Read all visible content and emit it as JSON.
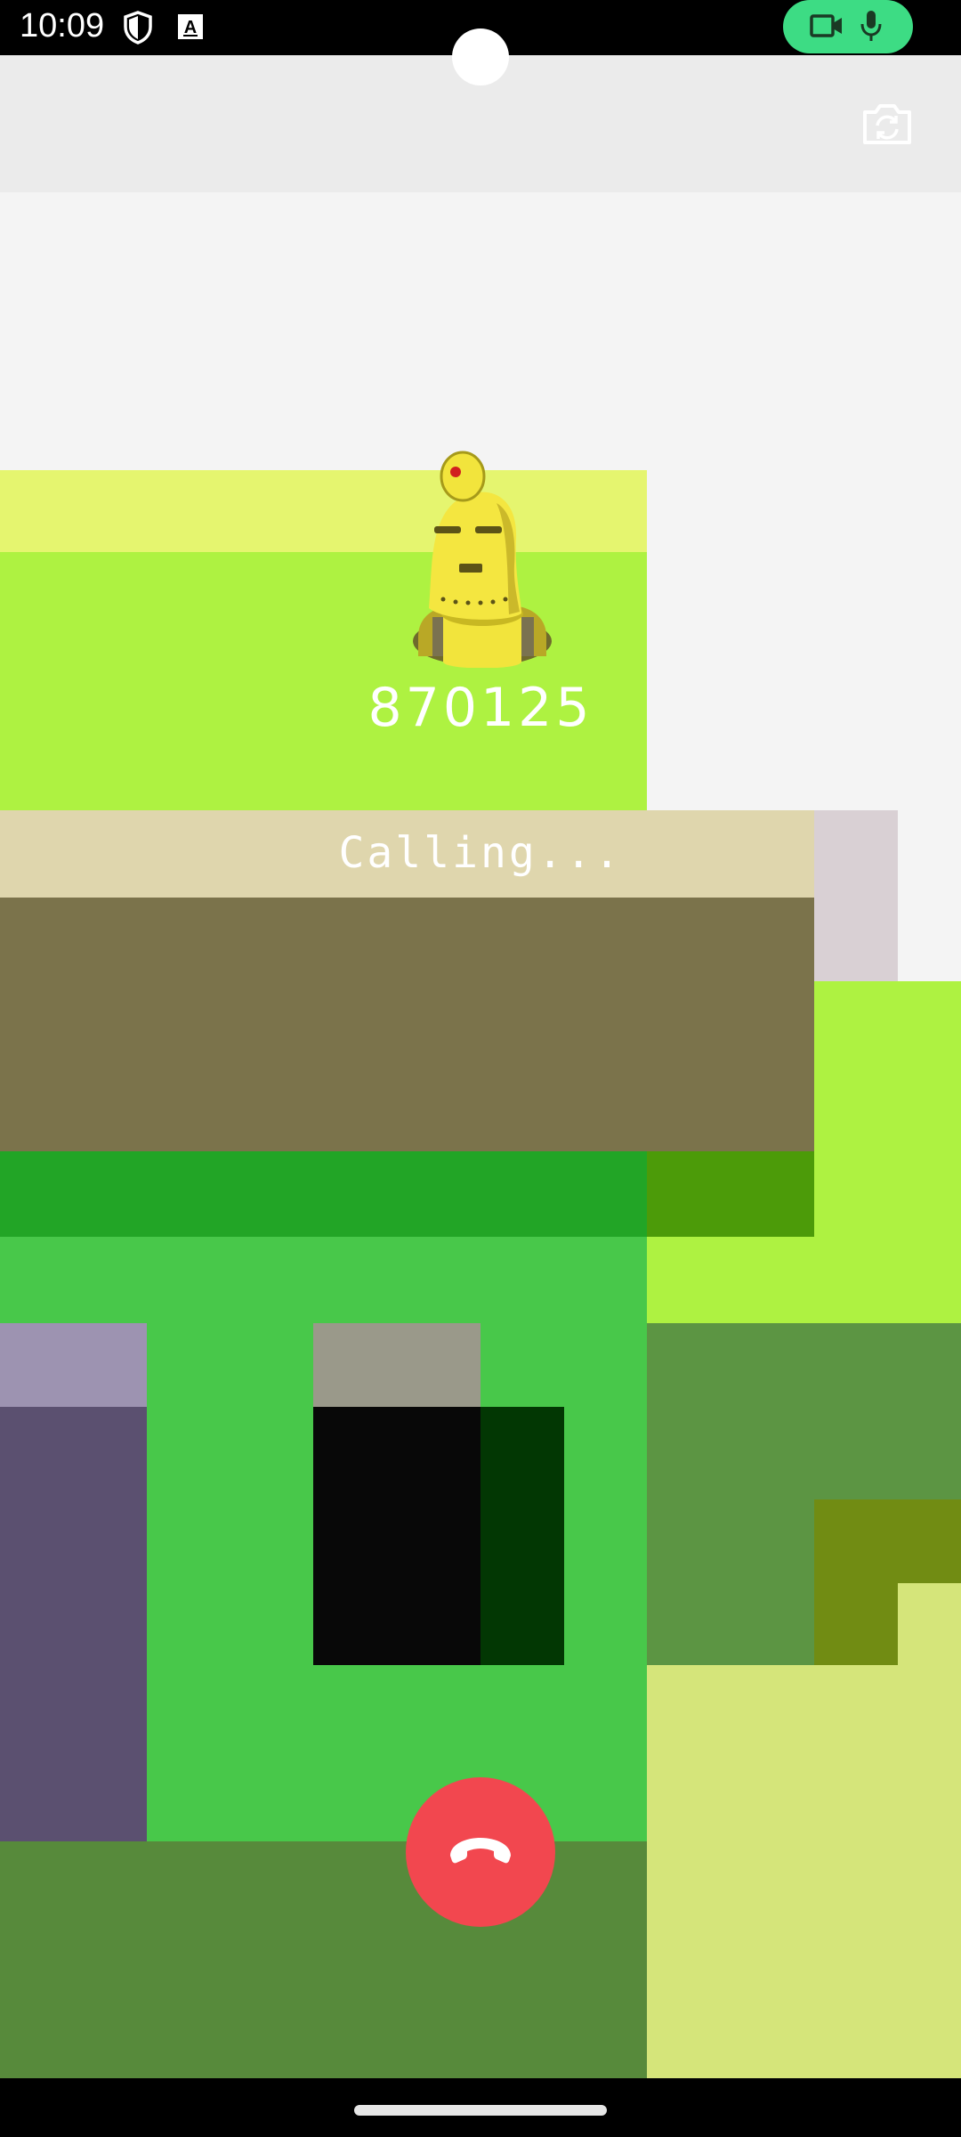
{
  "status_bar": {
    "time": "10:09",
    "icons": [
      "shield-icon",
      "keyboard-a-icon"
    ],
    "privacy_indicator": {
      "icons": [
        "video-camera-icon",
        "microphone-icon"
      ],
      "color": "#3ddc84"
    }
  },
  "call": {
    "caller_number": "870125",
    "status": "Calling...",
    "avatar": "robot-avatar"
  },
  "controls": {
    "flip_camera": "camera-flip-icon",
    "end_call": "phone-hangup-icon",
    "end_call_color": "#f2474f"
  }
}
